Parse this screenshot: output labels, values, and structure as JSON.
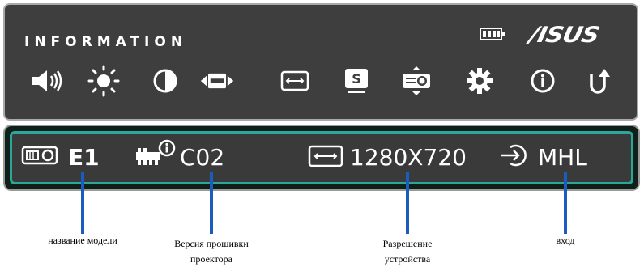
{
  "menu": {
    "title": "INFORMATION",
    "brand": "/ISUS",
    "icons": [
      "volume-icon",
      "brightness-icon",
      "contrast-icon",
      "aspect-ratio-icon",
      "resolution-icon",
      "splendid-mode-icon",
      "projector-setup-icon",
      "settings-gear-icon",
      "information-icon",
      "return-icon"
    ]
  },
  "info_bar": {
    "model_value": "E1",
    "firmware_value": "C02",
    "resolution_value": "1280X720",
    "input_value": "MHL"
  },
  "callouts": {
    "model": "название модели",
    "firmware": "Версия прошивки\nпроектора",
    "resolution": "Разрешение\nустройства",
    "input": "вход"
  },
  "colors": {
    "panel_background": "#3e3e3e",
    "info_border_accent": "#2aa79a",
    "pointer_line": "#1c5cc0"
  }
}
